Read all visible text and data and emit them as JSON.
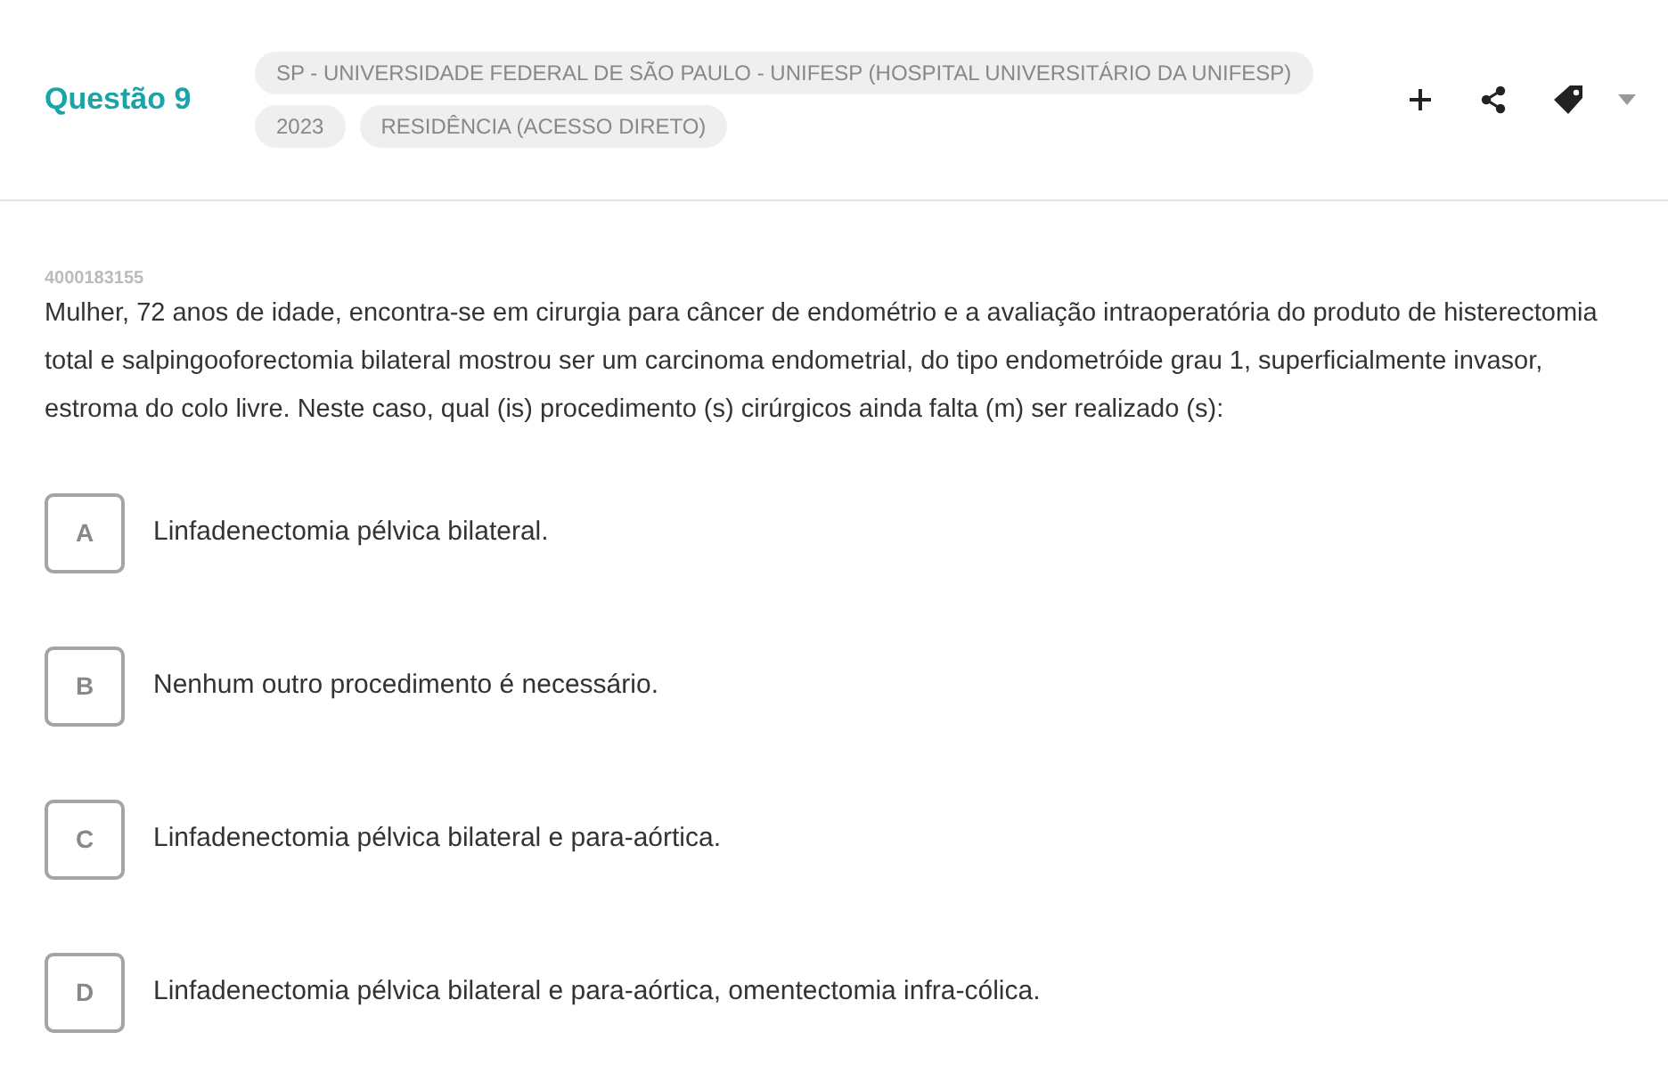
{
  "question": {
    "title": "Questão 9",
    "tags": [
      {
        "label": "SP - UNIVERSIDADE FEDERAL DE SÃO PAULO - UNIFESP (HOSPITAL UNIVERSITÁRIO DA UNIFESP)"
      },
      {
        "label": "2023"
      },
      {
        "label": "RESIDÊNCIA (ACESSO DIRETO)"
      }
    ],
    "code": "4000183155",
    "statement": "Mulher, 72 anos de idade, encontra-se em cirurgia para câncer de endométrio e a avaliação intraoperatória do produto de histerectomia total e salpingooforectomia bilateral mostrou ser um carcinoma endometrial, do tipo endometróide grau 1, superficialmente invasor, estroma do colo livre. Neste caso, qual (is) procedimento (s) cirúrgicos ainda falta (m) ser realizado (s):",
    "options": [
      {
        "letter": "A",
        "text": "Linfadenectomia pélvica bilateral.",
        "selected": false
      },
      {
        "letter": "B",
        "text": "Nenhum outro procedimento é necessário.",
        "selected": false
      },
      {
        "letter": "C",
        "text": "Linfadenectomia pélvica bilateral e para-aórtica.",
        "selected": false
      },
      {
        "letter": "D",
        "text": "Linfadenectomia pélvica bilateral e para-aórtica, omentectomia infra-cólica.",
        "selected": false
      }
    ]
  }
}
